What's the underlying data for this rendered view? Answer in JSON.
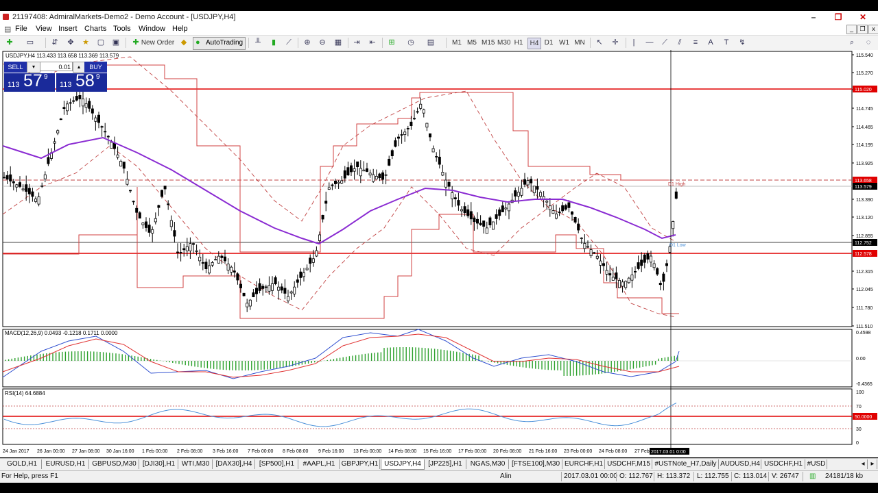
{
  "window": {
    "title": "21197408: AdmiralMarkets-Demo2 - Demo Account - [USDJPY,H4]",
    "controls": [
      "–",
      "❐",
      "✕"
    ]
  },
  "menu": [
    "File",
    "View",
    "Insert",
    "Charts",
    "Tools",
    "Window",
    "Help"
  ],
  "toolbar": {
    "new_order": "New Order",
    "autotrading": "AutoTrading",
    "timeframes": [
      "M1",
      "M5",
      "M15",
      "M30",
      "H1",
      "H4",
      "D1",
      "W1",
      "MN"
    ]
  },
  "chart": {
    "symbol_header": "USDJPY,H4  113.433 113.658 113.369 113.579",
    "macd_label": "MACD(12,26,9) 0.0493 -0.1218 0.1711 0.0000",
    "rsi_label": "RSI(14) 64.6884",
    "price_ticks": [
      "115.540",
      "115.270",
      "115.005",
      "114.745",
      "114.465",
      "114.195",
      "113.925",
      "113.658",
      "113.579",
      "113.390",
      "113.120",
      "112.855",
      "112.752",
      "112.578",
      "112.315",
      "112.045",
      "111.780",
      "111.510"
    ],
    "macd_ticks": [
      "0.4598",
      "0.00",
      "-0.4365"
    ],
    "rsi_ticks": [
      "100",
      "70",
      "50.0000",
      "30",
      "0"
    ],
    "time_ticks": [
      "24 Jan 2017",
      "26 Jan 00:00",
      "27 Jan 08:00",
      "30 Jan 16:00",
      "1 Feb 00:00",
      "2 Feb 08:00",
      "3 Feb 16:00",
      "7 Feb 00:00",
      "8 Feb 08:00",
      "9 Feb 16:00",
      "13 Feb 00:00",
      "14 Feb 08:00",
      "15 Feb 16:00",
      "17 Feb 00:00",
      "20 Feb 08:00",
      "21 Feb 16:00",
      "23 Feb 00:00",
      "24 Feb 08:00",
      "27 Feb"
    ],
    "crosshair_time": "2017.03.01 0:00",
    "pivot_high_label": "D1 High",
    "pivot_low_label": "D1 Low",
    "colors": {
      "hline": "#e00000",
      "ma": "#8a2bd2",
      "channel": "#d04040",
      "macd_signal": "#e03030",
      "macd_main": "#3050d0",
      "histogram": "#2ca02c",
      "rsi": "#4a90d9",
      "price_box": "#e00000",
      "crosshair_box": "#000000"
    }
  },
  "one_click": {
    "sell_label": "SELL",
    "buy_label": "BUY",
    "lot": "0.01",
    "sell_big": "113",
    "sell_pips": "57",
    "sell_point": "9",
    "buy_big": "113",
    "buy_pips": "58",
    "buy_point": "9"
  },
  "tabs": [
    "GOLD,H1",
    "EURUSD,H1",
    "GBPUSD,M30",
    "[DJI30],H1",
    "WTI,M30",
    "[DAX30],H4",
    "[SP500],H1",
    "#AAPL,H1",
    "GBPJPY,H1",
    "USDJPY,H4",
    "[JP225],H1",
    "NGAS,M30",
    "[FTSE100],M30",
    "EURCHF,H1",
    "USDCHF,M15",
    "#USTNote_H7,Daily",
    "AUDUSD,H4",
    "USDCHF,H1",
    "#USD"
  ],
  "active_tab": "USDJPY,H4",
  "status": {
    "help": "For Help, press F1",
    "profile": "Alin",
    "datetime": "2017.03.01 00:00",
    "open": "O: 112.767",
    "high": "H: 113.372",
    "low": "L: 112.755",
    "close": "C: 113.014",
    "volume": "V: 26747",
    "traffic": "24181/18 kb"
  }
}
